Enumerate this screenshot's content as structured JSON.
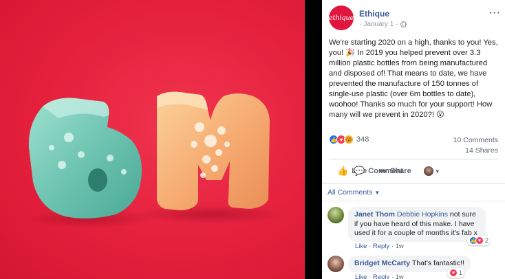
{
  "post": {
    "page_name": "Ethique",
    "avatar_text": "ethique",
    "date": "January 1",
    "separator": "·",
    "more": "···",
    "body": "We're starting 2020 on a high, thanks to you! Yes, you! 🎉 In 2019 you helped prevent over 3.3 million plastic bottles from being manufactured and disposed of! That means to date, we have prevented the manufacture of 150 tonnes of single-use plastic (over 6m bottles to date), woohoo! Thanks so much for your support! How many will we prevent in 2020?! 😮"
  },
  "reactions": {
    "icons": [
      "like-icon",
      "love-icon",
      "wow-icon"
    ],
    "count": "348",
    "comments": "10 Comments",
    "shares": "14 Shares"
  },
  "actions": {
    "like": "Like",
    "comment": "Comment",
    "share": "Share"
  },
  "comments_filter": "All Comments",
  "comments": [
    {
      "author": "Janet Thom",
      "tag": "Debbie Hopkins",
      "text": "not sure if you have heard of this make. I have used it for a couple of months it's fab x",
      "like": "Like",
      "reply": "Reply",
      "time": "1w",
      "reaction_count": "2"
    },
    {
      "author": "Bridget McCarty",
      "tag": "",
      "text": "That's fantastic!!",
      "like": "Like",
      "reply": "Reply",
      "time": "1w",
      "reaction_count": "1"
    }
  ],
  "colors": {
    "brand": "#e0163f",
    "link": "#385898",
    "photo_bg": "#e5203d",
    "soap_teal": "#6fc6b3",
    "soap_orange": "#f4a46a"
  }
}
